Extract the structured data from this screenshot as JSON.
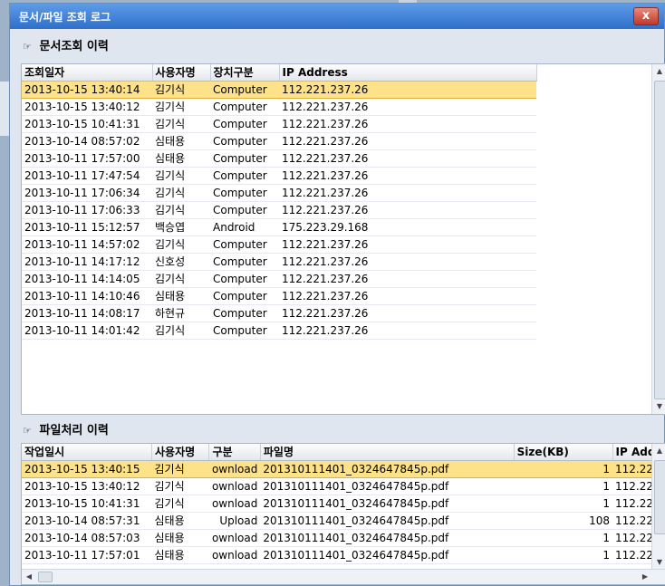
{
  "window": {
    "title": "문서/파일 조회 로그",
    "close_label": "x"
  },
  "doc_section": {
    "title": "문서조회 이력",
    "columns": [
      "조회일자",
      "사용자명",
      "장치구분",
      "IP Address"
    ],
    "rows": [
      [
        "2013-10-15 13:40:14",
        "김기식",
        "Computer",
        "112.221.237.26"
      ],
      [
        "2013-10-15 13:40:12",
        "김기식",
        "Computer",
        "112.221.237.26"
      ],
      [
        "2013-10-15 10:41:31",
        "김기식",
        "Computer",
        "112.221.237.26"
      ],
      [
        "2013-10-14 08:57:02",
        "심태용",
        "Computer",
        "112.221.237.26"
      ],
      [
        "2013-10-11 17:57:00",
        "심태용",
        "Computer",
        "112.221.237.26"
      ],
      [
        "2013-10-11 17:47:54",
        "김기식",
        "Computer",
        "112.221.237.26"
      ],
      [
        "2013-10-11 17:06:34",
        "김기식",
        "Computer",
        "112.221.237.26"
      ],
      [
        "2013-10-11 17:06:33",
        "김기식",
        "Computer",
        "112.221.237.26"
      ],
      [
        "2013-10-11 15:12:57",
        "백승엽",
        "Android",
        "175.223.29.168"
      ],
      [
        "2013-10-11 14:57:02",
        "김기식",
        "Computer",
        "112.221.237.26"
      ],
      [
        "2013-10-11 14:17:12",
        "신호성",
        "Computer",
        "112.221.237.26"
      ],
      [
        "2013-10-11 14:14:05",
        "김기식",
        "Computer",
        "112.221.237.26"
      ],
      [
        "2013-10-11 14:10:46",
        "심태용",
        "Computer",
        "112.221.237.26"
      ],
      [
        "2013-10-11 14:08:17",
        "하현규",
        "Computer",
        "112.221.237.26"
      ],
      [
        "2013-10-11 14:01:42",
        "김기식",
        "Computer",
        "112.221.237.26"
      ]
    ]
  },
  "file_section": {
    "title": "파일처리 이력",
    "columns": [
      "작업일시",
      "사용자명",
      "구분",
      "파일명",
      "Size(KB)",
      "IP Add"
    ],
    "rows": [
      [
        "2013-10-15 13:40:15",
        "김기식",
        "ownload",
        "201310111401_0324647845p.pdf",
        "1",
        "112.221."
      ],
      [
        "2013-10-15 13:40:12",
        "김기식",
        "ownload",
        "201310111401_0324647845p.pdf",
        "1",
        "112.221."
      ],
      [
        "2013-10-15 10:41:31",
        "김기식",
        "ownload",
        "201310111401_0324647845p.pdf",
        "1",
        "112.221."
      ],
      [
        "2013-10-14 08:57:31",
        "심태용",
        "Upload",
        "201310111401_0324647845p.pdf",
        "108",
        "112.221."
      ],
      [
        "2013-10-14 08:57:03",
        "심태용",
        "ownload",
        "201310111401_0324647845p.pdf",
        "1",
        "112.221."
      ],
      [
        "2013-10-11 17:57:01",
        "심태용",
        "ownload",
        "201310111401_0324647845p.pdf",
        "1",
        "112.221."
      ]
    ]
  },
  "icons": {
    "section": "edit-note-icon",
    "scroll_up": "triangle-up",
    "scroll_down": "triangle-down",
    "scroll_left": "triangle-left",
    "scroll_right": "triangle-right"
  },
  "colors": {
    "titlebar": "#2f6fc8",
    "selected_row": "#fde28a",
    "close": "#c0392b"
  }
}
